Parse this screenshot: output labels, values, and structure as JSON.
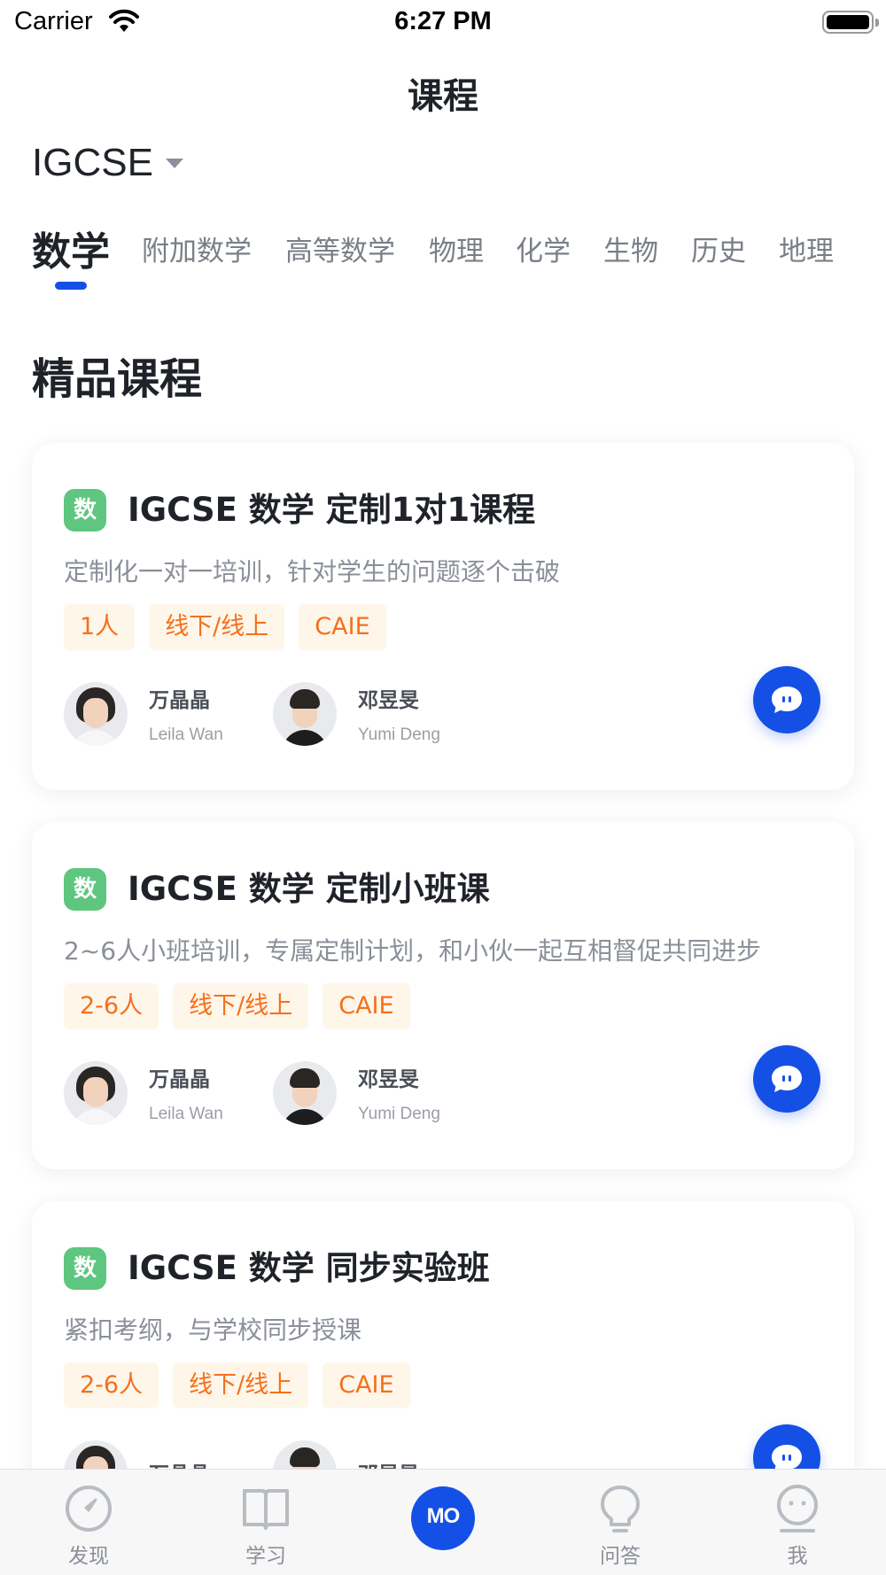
{
  "status_bar": {
    "carrier": "Carrier",
    "time": "6:27 PM"
  },
  "header": {
    "title": "课程"
  },
  "exam_selector": {
    "value": "IGCSE"
  },
  "subject_tabs": [
    {
      "label": "数学",
      "active": true
    },
    {
      "label": "附加数学",
      "active": false
    },
    {
      "label": "高等数学",
      "active": false
    },
    {
      "label": "物理",
      "active": false
    },
    {
      "label": "化学",
      "active": false
    },
    {
      "label": "生物",
      "active": false
    },
    {
      "label": "历史",
      "active": false
    },
    {
      "label": "地理",
      "active": false
    }
  ],
  "section": {
    "title": "精品课程"
  },
  "courses": [
    {
      "badge": "数",
      "title": "IGCSE 数学 定制1对1课程",
      "desc": "定制化一对一培训，针对学生的问题逐个击破",
      "tags": [
        "1人",
        "线下/线上",
        "CAIE"
      ],
      "teachers": [
        {
          "name": "万晶晶",
          "en": "Leila Wan"
        },
        {
          "name": "邓昱旻",
          "en": "Yumi Deng"
        }
      ]
    },
    {
      "badge": "数",
      "title": "IGCSE 数学 定制小班课",
      "desc": "2~6人小班培训，专属定制计划，和小伙一起互相督促共同进步",
      "tags": [
        "2-6人",
        "线下/线上",
        "CAIE"
      ],
      "teachers": [
        {
          "name": "万晶晶",
          "en": "Leila Wan"
        },
        {
          "name": "邓昱旻",
          "en": "Yumi Deng"
        }
      ]
    },
    {
      "badge": "数",
      "title": "IGCSE 数学 同步实验班",
      "desc": "紧扣考纲，与学校同步授课",
      "tags": [
        "2-6人",
        "线下/线上",
        "CAIE"
      ],
      "teachers": [
        {
          "name": "万晶晶",
          "en": ""
        },
        {
          "name": "邓昱旻",
          "en": ""
        }
      ]
    }
  ],
  "tabbar": {
    "items": [
      {
        "label": "发现",
        "icon": "compass-icon"
      },
      {
        "label": "学习",
        "icon": "book-icon"
      },
      {
        "label": "问答",
        "icon": "lightbulb-icon"
      },
      {
        "label": "我",
        "icon": "face-icon"
      }
    ],
    "center_logo": "MO"
  },
  "colors": {
    "accent": "#1550e6",
    "badge": "#5ec67f",
    "tag_text": "#f5701c",
    "tag_bg": "#fff6ea"
  }
}
